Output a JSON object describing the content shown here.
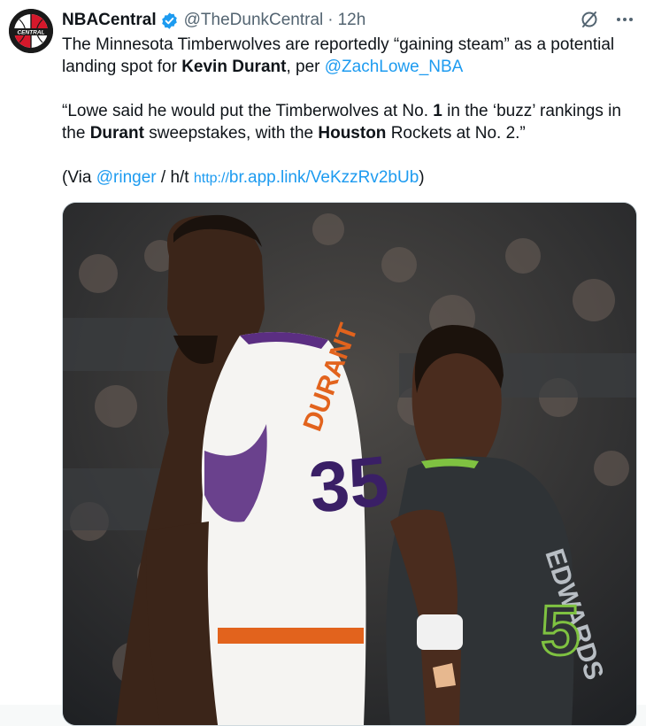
{
  "tweet": {
    "author": {
      "name": "NBACentral",
      "handle": "@TheDunkCentral",
      "separator": "·",
      "time": "12h",
      "avatar_text": "CENTRAL"
    },
    "text": {
      "p1_a": "The Minnesota Timberwolves are reportedly “gaining steam” as a potential landing spot for ",
      "p1_bold": "Kevin Durant",
      "p1_b": ", per ",
      "p1_link": "@ZachLowe_NBA",
      "p2_a": "“Lowe said he would put the Timberwolves at No. ",
      "p2_num": "1",
      "p2_b": " in the ‘buzz’ rankings in the ",
      "p2_bold1": "Durant",
      "p2_c": " sweepstakes, with the ",
      "p2_bold2": "Houston",
      "p2_d": " Rockets at No. 2.”",
      "p3_a": "(Via ",
      "p3_link": "@ringer",
      "p3_b": " / h/t ",
      "p3_url_proto": "http://",
      "p3_url_rest": "br.app.link/VeKzzRv2bUb",
      "p3_c": ")"
    },
    "media": {
      "jersey_left_name": "DURANT",
      "jersey_left_number": "35",
      "jersey_right_name": "EDWARDS",
      "jersey_right_number": "5"
    },
    "icons": [
      "verified-badge-icon",
      "grok-icon",
      "more-icon"
    ],
    "colors": {
      "link": "#1d9bf0",
      "verified": "#1d9bf0",
      "secondary_text": "#536471"
    }
  }
}
